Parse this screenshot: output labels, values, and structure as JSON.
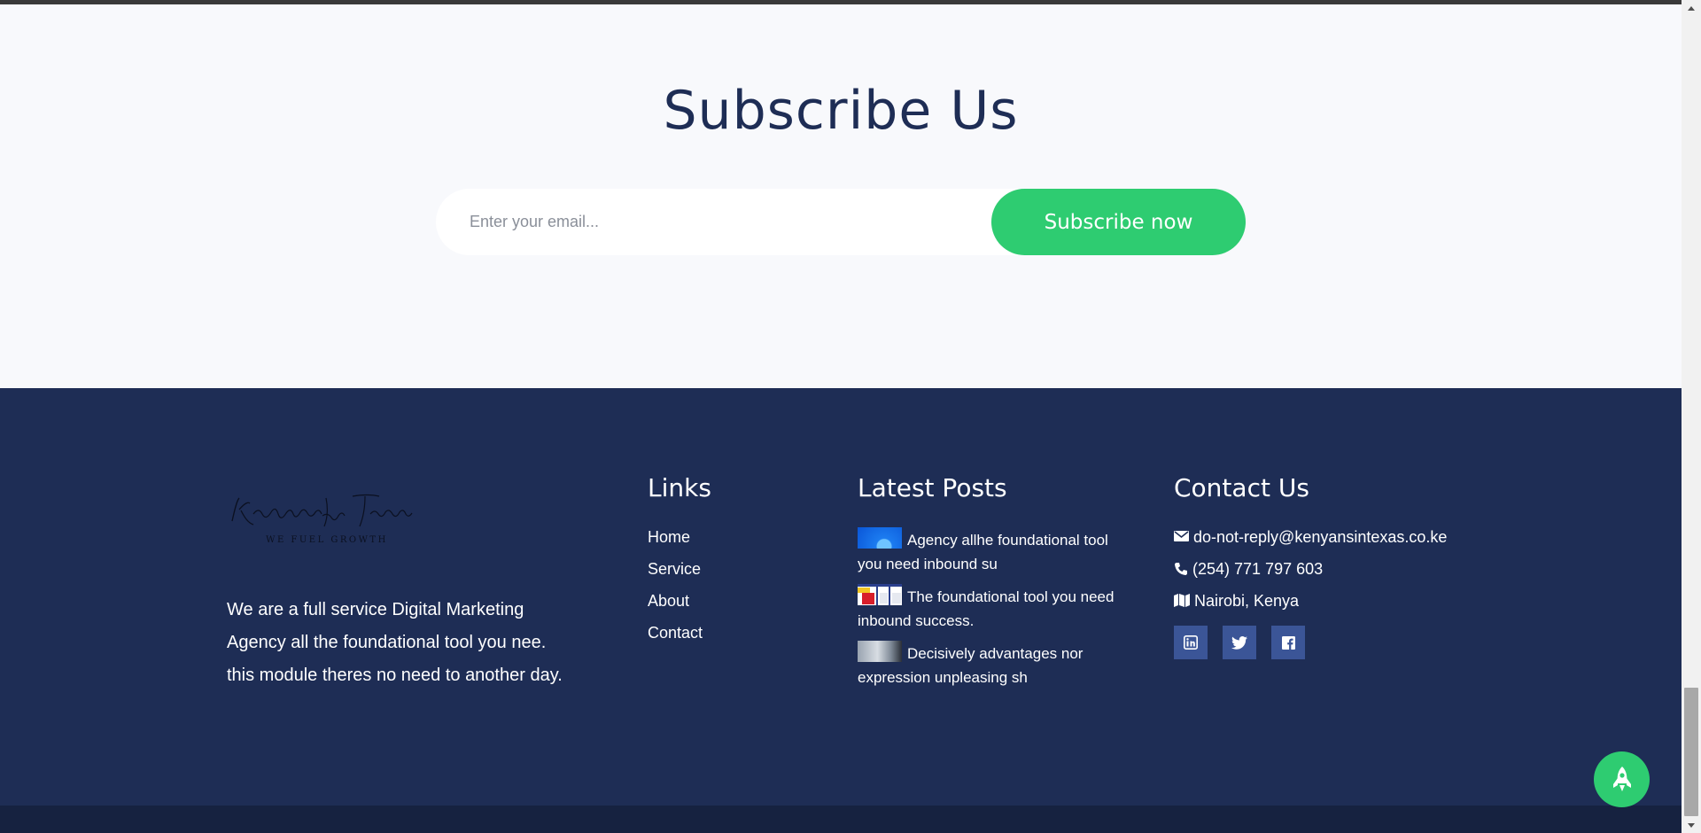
{
  "subscribe": {
    "title": "Subscribe Us",
    "email_placeholder": "Enter your email...",
    "button_label": "Subscribe now"
  },
  "footer": {
    "logo": {
      "text": "Kenyans In Texas",
      "tagline": "WE FUEL GROWTH"
    },
    "about": " We are a full service Digital Marketing Agency all the foundational tool you nee. this module theres no need to another day.",
    "links": {
      "title": "Links",
      "items": [
        {
          "label": "Home"
        },
        {
          "label": "Service"
        },
        {
          "label": "About"
        },
        {
          "label": "Contact"
        }
      ]
    },
    "posts": {
      "title": "Latest Posts",
      "items": [
        {
          "title": "Agency allhe foundational tool you need inbound su"
        },
        {
          "title": "The foundational tool you need inbound success."
        },
        {
          "title": "Decisively advantages nor expression unpleasing sh"
        }
      ]
    },
    "contact": {
      "title": "Contact Us",
      "email": "do-not-reply@kenyansintexas.co.ke",
      "phone": "(254) 771 797 603",
      "address": "Nairobi, Kenya"
    },
    "socials": [
      {
        "icon": "linkedin-icon"
      },
      {
        "icon": "twitter-icon"
      },
      {
        "icon": "facebook-icon"
      }
    ]
  },
  "colors": {
    "navy": "#1e2d55",
    "green": "#2ecc71",
    "social_bg": "#3b5597",
    "page_bg": "#f8f9fc"
  },
  "back_to_top": {
    "icon": "rocket-icon"
  }
}
